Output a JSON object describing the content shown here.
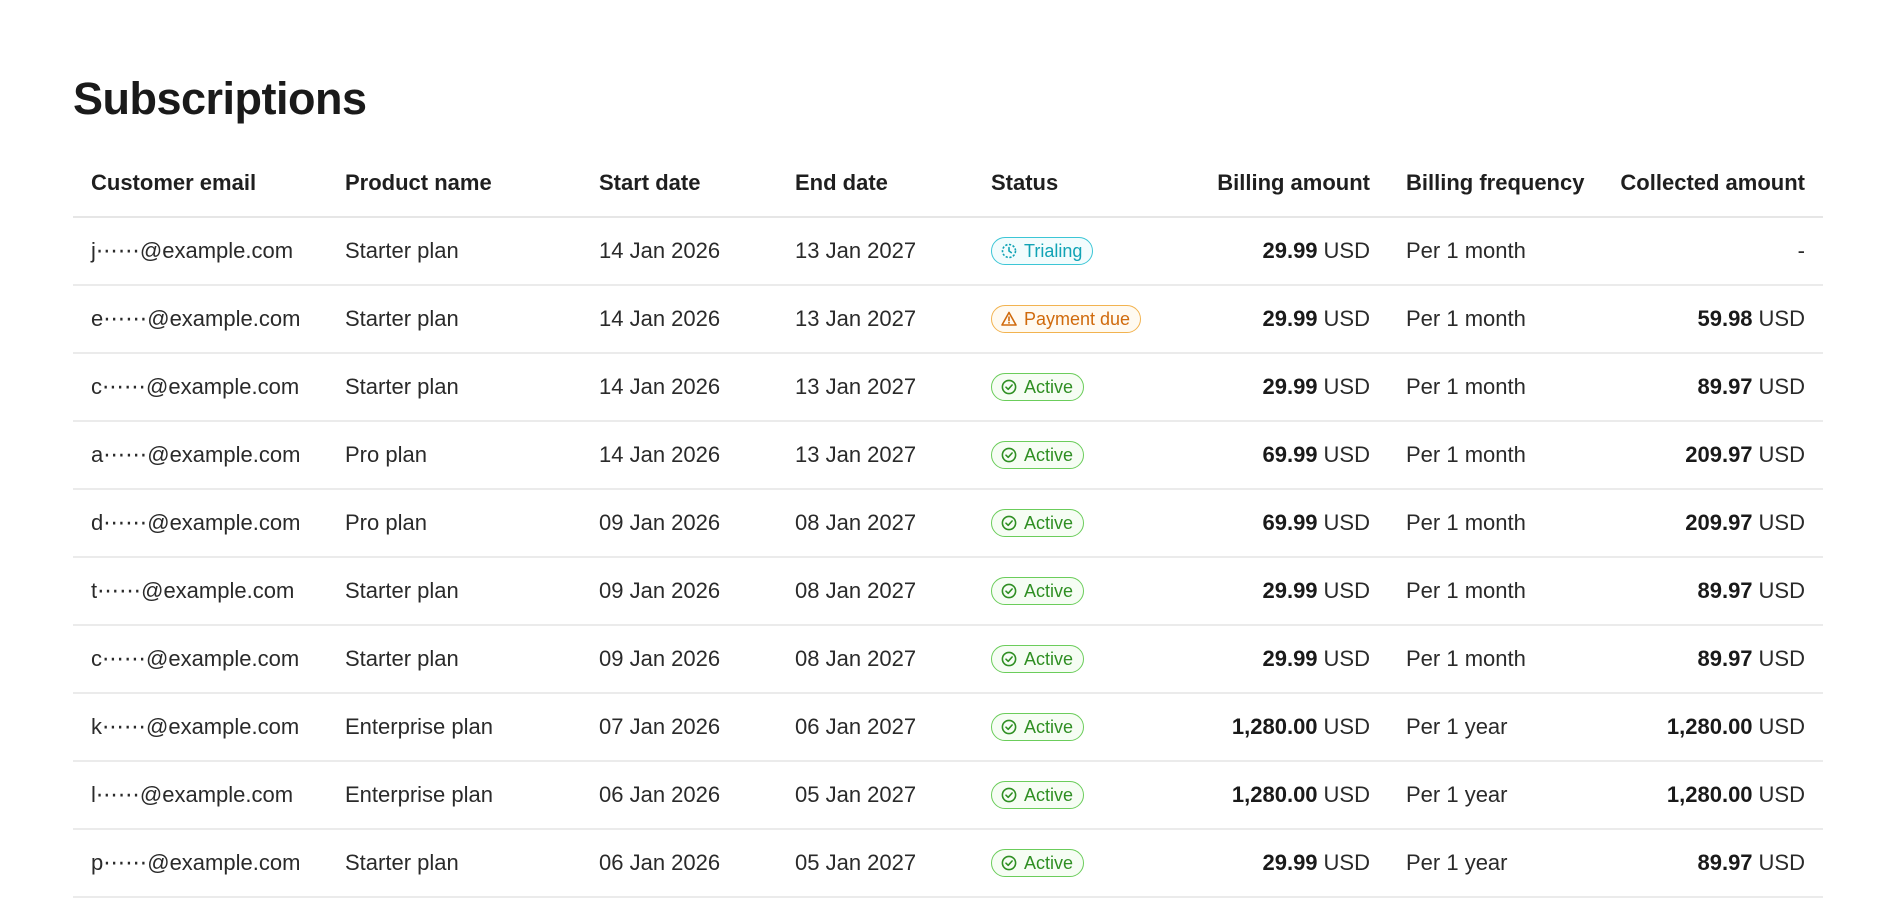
{
  "page": {
    "title": "Subscriptions"
  },
  "table": {
    "columns": [
      "Customer email",
      "Product name",
      "Start date",
      "End date",
      "Status",
      "Billing amount",
      "Billing frequency",
      "Collected amount"
    ],
    "rows": [
      {
        "email": "j⋯⋯@example.com",
        "product": "Starter plan",
        "start": "14 Jan 2026",
        "end": "13 Jan 2027",
        "status": "Trialing",
        "status_kind": "trialing",
        "billing_value": "29.99",
        "billing_currency": "USD",
        "frequency": "Per 1 month",
        "collected_value": "-",
        "collected_currency": ""
      },
      {
        "email": "e⋯⋯@example.com",
        "product": "Starter plan",
        "start": "14 Jan 2026",
        "end": "13 Jan 2027",
        "status": "Payment due",
        "status_kind": "payment-due",
        "billing_value": "29.99",
        "billing_currency": "USD",
        "frequency": "Per 1 month",
        "collected_value": "59.98",
        "collected_currency": "USD"
      },
      {
        "email": "c⋯⋯@example.com",
        "product": "Starter plan",
        "start": "14 Jan 2026",
        "end": "13 Jan 2027",
        "status": "Active",
        "status_kind": "active",
        "billing_value": "29.99",
        "billing_currency": "USD",
        "frequency": "Per 1 month",
        "collected_value": "89.97",
        "collected_currency": "USD"
      },
      {
        "email": "a⋯⋯@example.com",
        "product": "Pro plan",
        "start": "14 Jan 2026",
        "end": "13 Jan 2027",
        "status": "Active",
        "status_kind": "active",
        "billing_value": "69.99",
        "billing_currency": "USD",
        "frequency": "Per 1 month",
        "collected_value": "209.97",
        "collected_currency": "USD"
      },
      {
        "email": "d⋯⋯@example.com",
        "product": "Pro plan",
        "start": "09 Jan 2026",
        "end": "08 Jan 2027",
        "status": "Active",
        "status_kind": "active",
        "billing_value": "69.99",
        "billing_currency": "USD",
        "frequency": "Per 1 month",
        "collected_value": "209.97",
        "collected_currency": "USD"
      },
      {
        "email": "t⋯⋯@example.com",
        "product": "Starter plan",
        "start": "09 Jan 2026",
        "end": "08 Jan 2027",
        "status": "Active",
        "status_kind": "active",
        "billing_value": "29.99",
        "billing_currency": "USD",
        "frequency": "Per 1 month",
        "collected_value": "89.97",
        "collected_currency": "USD"
      },
      {
        "email": "c⋯⋯@example.com",
        "product": "Starter plan",
        "start": "09 Jan 2026",
        "end": "08 Jan 2027",
        "status": "Active",
        "status_kind": "active",
        "billing_value": "29.99",
        "billing_currency": "USD",
        "frequency": "Per 1 month",
        "collected_value": "89.97",
        "collected_currency": "USD"
      },
      {
        "email": "k⋯⋯@example.com",
        "product": "Enterprise plan",
        "start": "07 Jan 2026",
        "end": "06 Jan 2027",
        "status": "Active",
        "status_kind": "active",
        "billing_value": "1,280.00",
        "billing_currency": "USD",
        "frequency": "Per 1 year",
        "collected_value": "1,280.00",
        "collected_currency": "USD"
      },
      {
        "email": "l⋯⋯@example.com",
        "product": "Enterprise plan",
        "start": "06 Jan 2026",
        "end": "05 Jan 2027",
        "status": "Active",
        "status_kind": "active",
        "billing_value": "1,280.00",
        "billing_currency": "USD",
        "frequency": "Per 1 year",
        "collected_value": "1,280.00",
        "collected_currency": "USD"
      },
      {
        "email": "p⋯⋯@example.com",
        "product": "Starter plan",
        "start": "06 Jan 2026",
        "end": "05 Jan 2027",
        "status": "Active",
        "status_kind": "active",
        "billing_value": "29.99",
        "billing_currency": "USD",
        "frequency": "Per 1 year",
        "collected_value": "89.97",
        "collected_currency": "USD"
      }
    ]
  },
  "status_icons": {
    "trialing": "clock-dashed-icon",
    "payment-due": "warning-triangle-icon",
    "active": "check-circle-icon"
  },
  "colors": {
    "trialing": "#11a3b5",
    "payment_due": "#d06a0c",
    "active": "#2f8f23"
  }
}
